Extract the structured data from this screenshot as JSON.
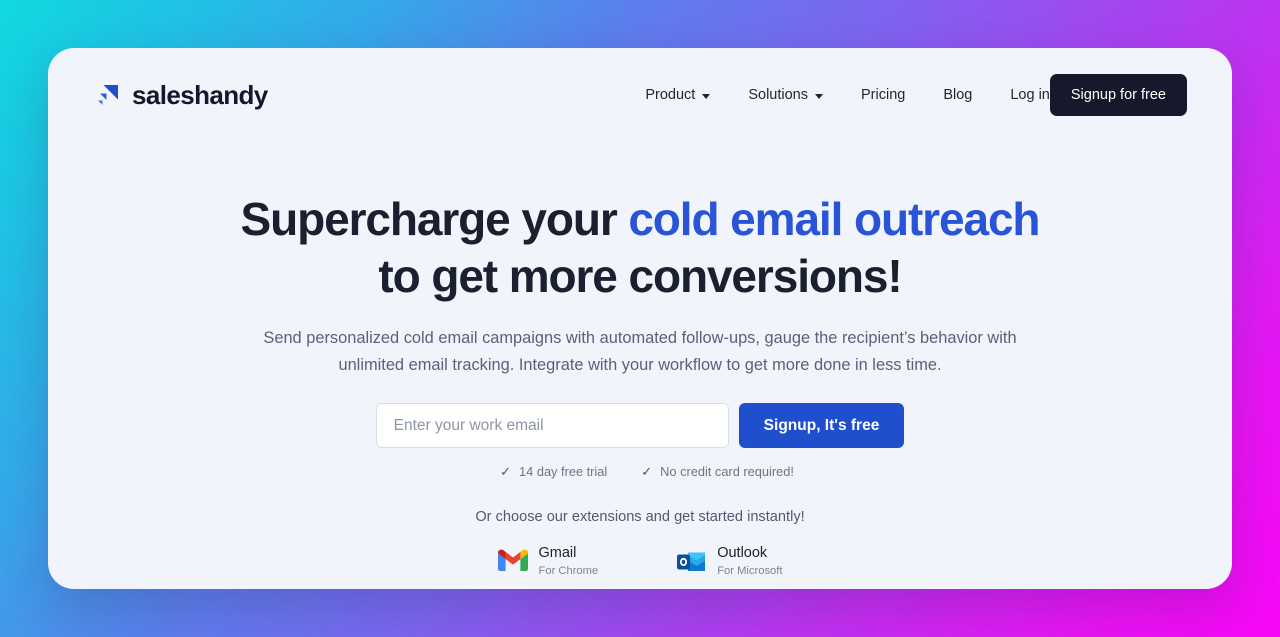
{
  "brand": {
    "name": "saleshandy",
    "logo_icon": "saleshandy-arrow-icon",
    "accent_blue": "#2a54d6",
    "button_blue": "#1f4fcd",
    "dark": "#15192b"
  },
  "nav": {
    "items": [
      {
        "label": "Product",
        "has_dropdown": true,
        "icon": "chevron-down-icon"
      },
      {
        "label": "Solutions",
        "has_dropdown": true,
        "icon": "chevron-down-icon"
      },
      {
        "label": "Pricing",
        "has_dropdown": false
      },
      {
        "label": "Blog",
        "has_dropdown": false
      }
    ],
    "login_label": "Log in",
    "signup_label": "Signup for free"
  },
  "hero": {
    "headline_part1": "Supercharge your ",
    "headline_accent": "cold email outreach",
    "headline_line2": "to get more conversions!",
    "subheadline": "Send personalized cold email campaigns with automated follow-ups, gauge the recipient’s behavior with unlimited email tracking. Integrate with your workflow to get more done in less time.",
    "email_placeholder": "Enter your work email",
    "email_value": "",
    "cta_label": "Signup, It's free",
    "perks": [
      {
        "icon": "check-icon",
        "label": "14 day free trial"
      },
      {
        "icon": "check-icon",
        "label": "No credit card required!"
      }
    ]
  },
  "extensions": {
    "label": "Or choose our extensions and get started instantly!",
    "items": [
      {
        "icon": "gmail-icon",
        "name": "Gmail",
        "sub": "For Chrome"
      },
      {
        "icon": "outlook-icon",
        "name": "Outlook",
        "sub": "For Microsoft"
      }
    ]
  }
}
